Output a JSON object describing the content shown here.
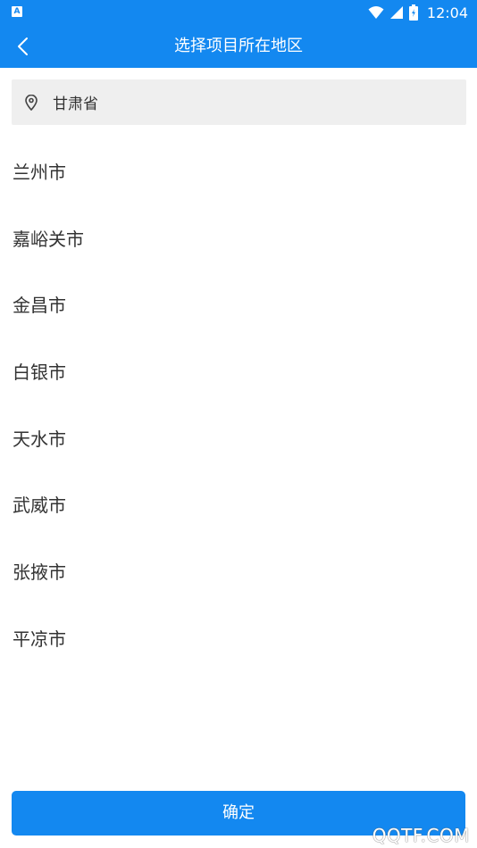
{
  "status_bar": {
    "app_badge": "A",
    "time": "12:04"
  },
  "header": {
    "title": "选择项目所在地区"
  },
  "region": {
    "label": "甘肃省"
  },
  "cities": [
    "兰州市",
    "嘉峪关市",
    "金昌市",
    "白银市",
    "天水市",
    "武威市",
    "张掖市",
    "平凉市"
  ],
  "confirm": {
    "label": "确定"
  },
  "watermark": "QQTF.COM",
  "colors": {
    "primary": "#1388f0",
    "region_bg": "#efefef",
    "text": "#333333"
  },
  "icons": {
    "back": "chevron-left-icon",
    "location": "location-pin-icon",
    "wifi": "wifi-icon",
    "signal": "signal-icon",
    "battery": "battery-icon"
  }
}
